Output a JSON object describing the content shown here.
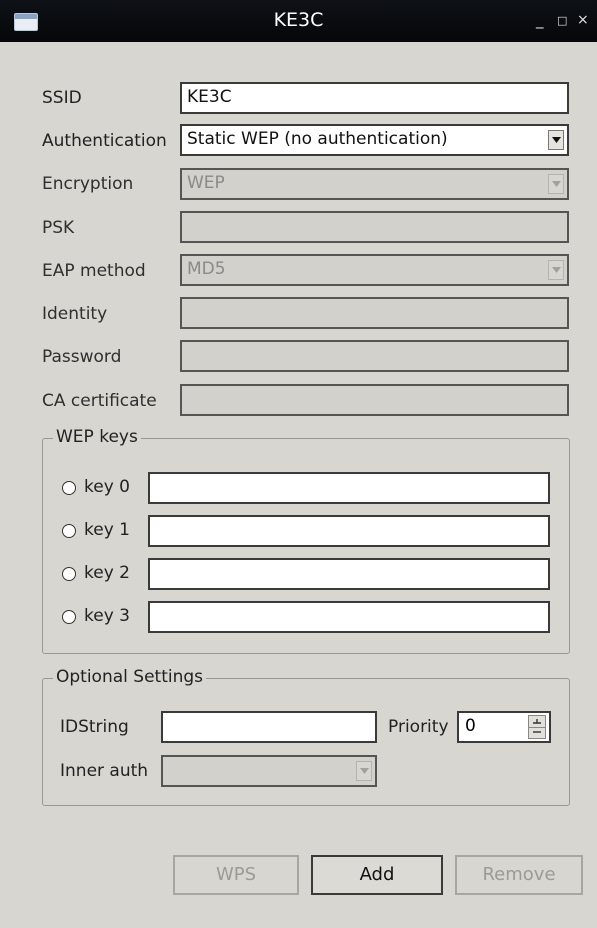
{
  "window": {
    "title": "KE3C",
    "minimize": "_",
    "maximize": "□",
    "close": "×"
  },
  "form": {
    "ssid_label": "SSID",
    "ssid_value": "KE3C",
    "authentication_label": "Authentication",
    "authentication_value": "Static WEP (no authentication)",
    "encryption_label": "Encryption",
    "encryption_value": "WEP",
    "psk_label": "PSK",
    "psk_value": "",
    "eap_method_label": "EAP method",
    "eap_method_value": "MD5",
    "identity_label": "Identity",
    "identity_value": "",
    "password_label": "Password",
    "password_value": "",
    "ca_certificate_label": "CA certificate",
    "ca_certificate_value": ""
  },
  "wep_keys": {
    "title": "WEP keys",
    "keys": [
      {
        "label": "key 0",
        "value": ""
      },
      {
        "label": "key 1",
        "value": ""
      },
      {
        "label": "key 2",
        "value": ""
      },
      {
        "label": "key 3",
        "value": ""
      }
    ]
  },
  "optional": {
    "title": "Optional Settings",
    "idstring_label": "IDString",
    "idstring_value": "",
    "priority_label": "Priority",
    "priority_value": "0",
    "inner_auth_label": "Inner auth",
    "inner_auth_value": ""
  },
  "buttons": {
    "wps": "WPS",
    "add": "Add",
    "remove": "Remove"
  }
}
